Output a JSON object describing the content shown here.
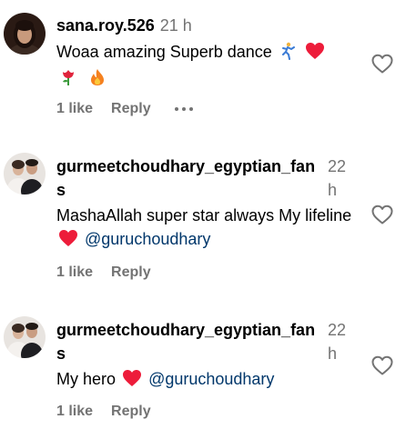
{
  "comments": [
    {
      "username": "sana.roy.526",
      "time": "21 h",
      "text_part1": "Woaa amazing Superb dance",
      "emoji_icons": [
        "dancing-person-icon",
        "red-heart-icon",
        "rose-icon",
        "fire-icon"
      ],
      "likes_label": "1 like",
      "reply_label": "Reply"
    },
    {
      "username": "gurmeetchoudhary_egyptian_fans",
      "time_line1": "22",
      "time_line2": "h",
      "text_part1": "MashaAllah super star always My lifeline",
      "mention": "@guruchoudhary",
      "emoji_icons": [
        "red-heart-icon"
      ],
      "likes_label": "1 like",
      "reply_label": "Reply"
    },
    {
      "username": "gurmeetchoudhary_egyptian_fans",
      "time_line1": "22",
      "time_line2": "h",
      "text_part1": "My hero",
      "mention": "@guruchoudhary",
      "emoji_icons": [
        "red-heart-icon"
      ],
      "likes_label": "1 like",
      "reply_label": "Reply"
    }
  ],
  "colors": {
    "text": "#000000",
    "secondary": "#737373",
    "mention": "#00376b",
    "heart": "#ed1c3a"
  }
}
